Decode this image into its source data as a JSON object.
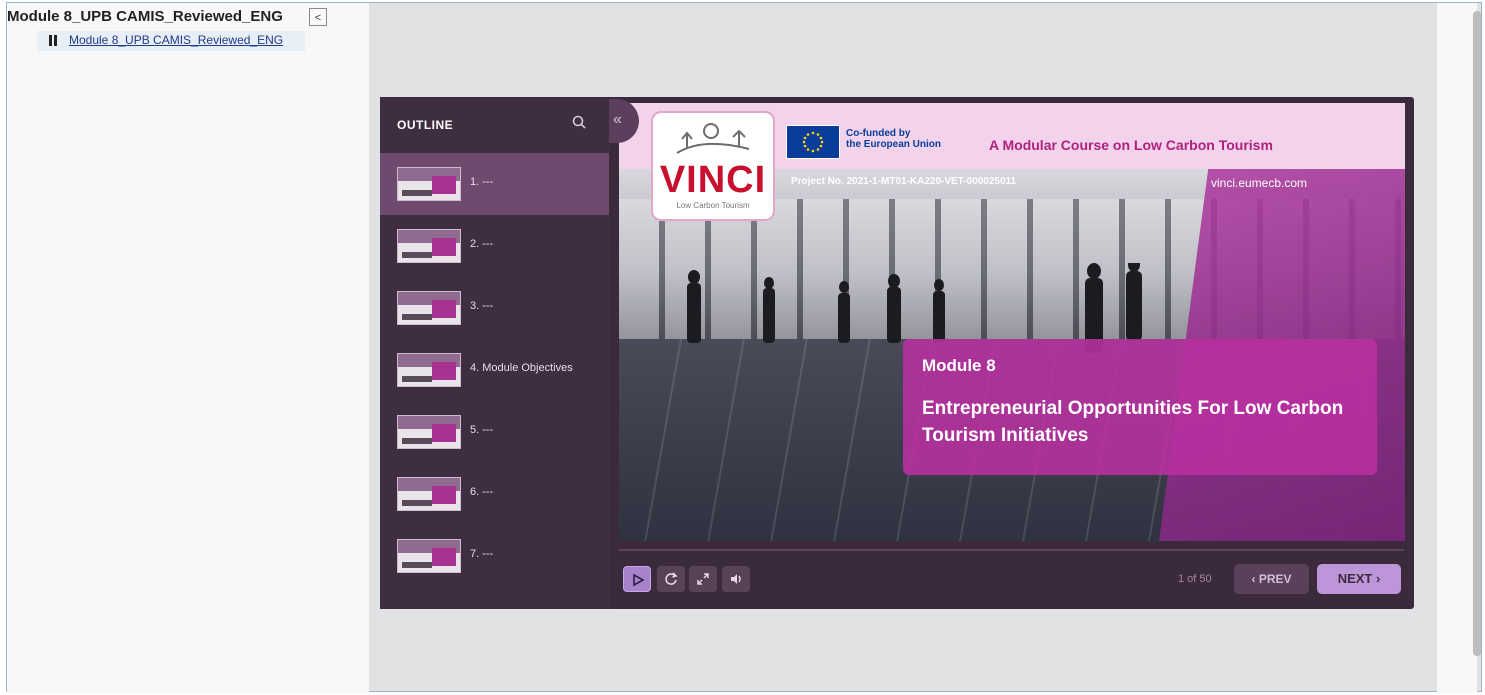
{
  "window": {
    "title": "Module 8_UPB CAMIS_Reviewed_ENG",
    "collapse_label": "<",
    "tree_item": "Module 8_UPB CAMIS_Reviewed_ENG"
  },
  "outline": {
    "heading": "OUTLINE",
    "items": [
      {
        "label": "1. ---",
        "active": true
      },
      {
        "label": "2. ---"
      },
      {
        "label": "3. ---"
      },
      {
        "label": "4. Module Objectives"
      },
      {
        "label": "5. ---"
      },
      {
        "label": "6. ---"
      },
      {
        "label": "7. ---"
      }
    ],
    "collapse_icon": "«"
  },
  "slide": {
    "logo_text": "VINCI",
    "logo_subtitle": "Low Carbon Tourism",
    "cofund_line1": "Co-funded by",
    "cofund_line2": "the European Union",
    "course_title": "A Modular Course on Low Carbon Tourism",
    "project": "Project No. 2021-1-MT01-KA220-VET-000025011",
    "website": "vinci.eumecb.com",
    "module_number": "Module 8",
    "module_title": "Entrepreneurial Opportunities For Low Carbon Tourism Initiatives"
  },
  "controls": {
    "counter": "1 of 50",
    "prev_label": "PREV",
    "next_label": "NEXT",
    "icons": [
      "play-icon",
      "replay-icon",
      "fullscreen-icon",
      "volume-icon"
    ]
  },
  "colors": {
    "accent": "#a783cc",
    "magenta": "#b0217d",
    "player_bg": "#3b2a3c"
  }
}
